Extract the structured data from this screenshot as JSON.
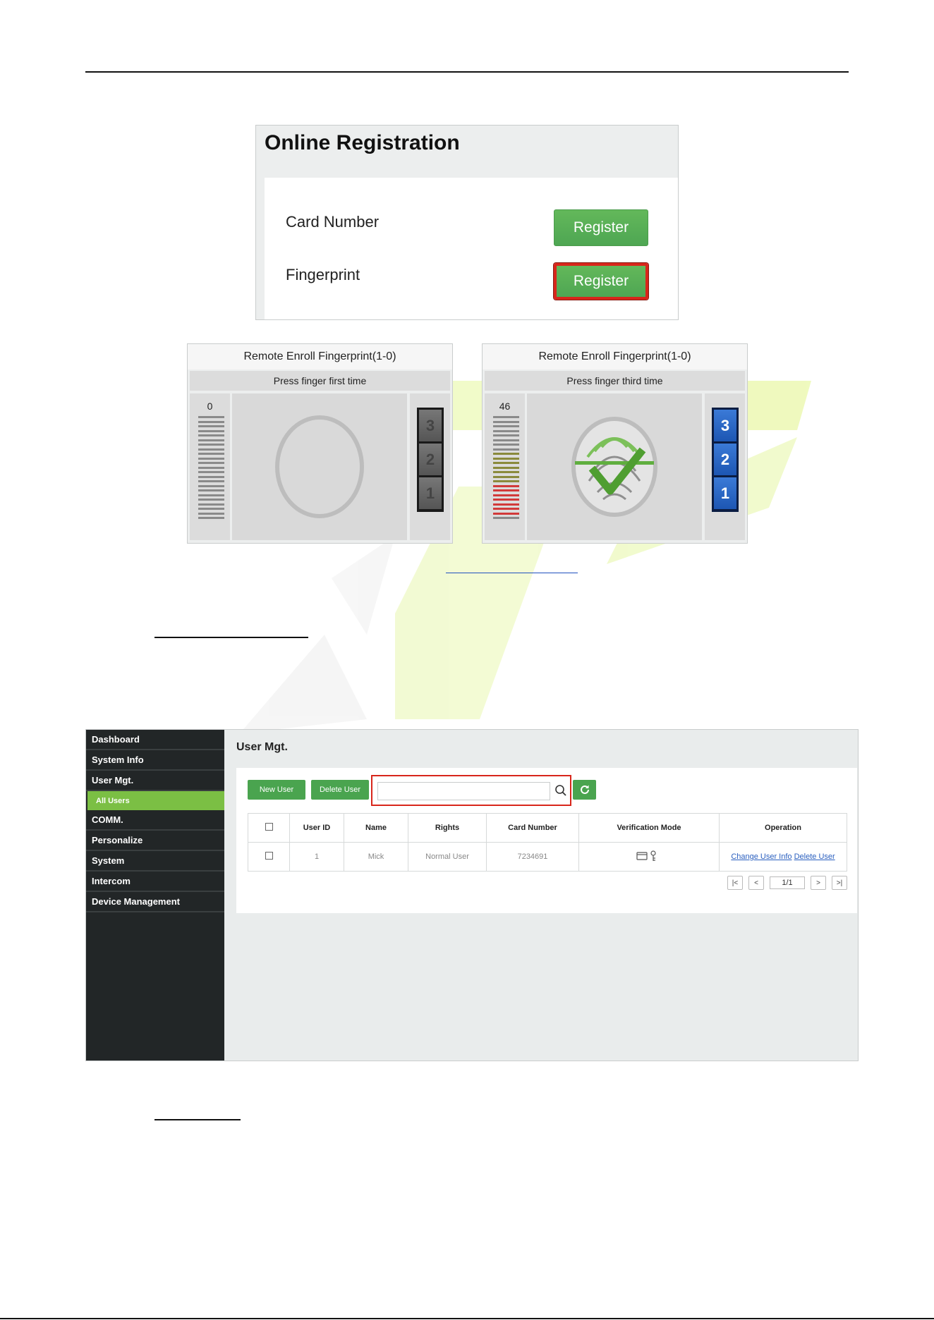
{
  "online_registration": {
    "title": "Online Registration",
    "rows": [
      {
        "label": "Card Number",
        "button": "Register"
      },
      {
        "label": "Fingerprint",
        "button": "Register"
      }
    ]
  },
  "enroll_panels": [
    {
      "title": "Remote Enroll Fingerprint(1-0)",
      "instruction": "Press finger first time",
      "quality": "0",
      "stack": [
        "3",
        "2",
        "1"
      ]
    },
    {
      "title": "Remote Enroll Fingerprint(1-0)",
      "instruction": "Press finger third time",
      "quality": "46",
      "stack": [
        "3",
        "2",
        "1"
      ]
    }
  ],
  "colors": {
    "accent_green": "#4aa44f",
    "highlight_red": "#d8261b",
    "sidebar_bg": "#222627",
    "active_sub": "#7bbf44"
  },
  "user_mgt": {
    "sidebar": [
      "Dashboard",
      "System Info",
      "User Mgt."
    ],
    "sidebar_active_sub": "All Users",
    "sidebar_rest": [
      "COMM.",
      "Personalize",
      "System",
      "Intercom",
      "Device Management"
    ],
    "title": "User Mgt.",
    "buttons": {
      "new_user": "New User",
      "delete_user": "Delete User"
    },
    "search": {
      "value": "",
      "icon": "search-icon"
    },
    "refresh_icon": "refresh-icon",
    "table": {
      "headers": [
        "User ID",
        "Name",
        "Rights",
        "Card Number",
        "Verification Mode",
        "Operation"
      ],
      "rows": [
        {
          "id": "1",
          "name": "Mick",
          "rights": "Normal User",
          "card": "7234691",
          "modes": [
            "card-icon",
            "key-icon"
          ],
          "op_change": "Change User Info",
          "op_delete": "Delete User"
        }
      ]
    },
    "pager": {
      "page": "1/1"
    }
  }
}
